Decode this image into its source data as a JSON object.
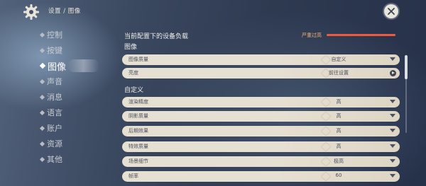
{
  "header": {
    "breadcrumb": "设置 / 图像",
    "icon": "gear-icon",
    "close_icon": "close-icon"
  },
  "sidebar": {
    "items": [
      {
        "label": "控制",
        "active": false
      },
      {
        "label": "按键",
        "active": false
      },
      {
        "label": "图像",
        "active": true
      },
      {
        "label": "声音",
        "active": false
      },
      {
        "label": "消息",
        "active": false
      },
      {
        "label": "语言",
        "active": false
      },
      {
        "label": "账户",
        "active": false
      },
      {
        "label": "资源",
        "active": false
      },
      {
        "label": "其他",
        "active": false
      }
    ]
  },
  "load": {
    "title": "当前配置下的设备负载",
    "status": "严重过高",
    "fill_fraction": 1.0,
    "fill_color": "#ef5a3f"
  },
  "sections": {
    "image": "图像",
    "custom": "自定义"
  },
  "rows": [
    {
      "label": "图像质量",
      "value": "自定义",
      "control": "dropdown"
    },
    {
      "label": "亮度",
      "value": "前往设置",
      "control": "goto"
    },
    {
      "label": "渲染精度",
      "value": "高",
      "control": "dropdown"
    },
    {
      "label": "阴影质量",
      "value": "高",
      "control": "dropdown"
    },
    {
      "label": "后期效果",
      "value": "高",
      "control": "dropdown"
    },
    {
      "label": "特效质量",
      "value": "高",
      "control": "dropdown"
    },
    {
      "label": "场景细节",
      "value": "极高",
      "control": "dropdown"
    },
    {
      "label": "帧率",
      "value": "60",
      "control": "dropdown"
    }
  ]
}
